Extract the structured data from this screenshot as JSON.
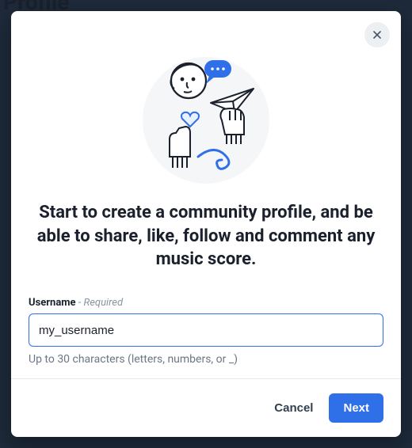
{
  "background": {
    "page_title": "Profile"
  },
  "modal": {
    "heading": "Start to create a community profile, and be able to share, like, follow and comment any music score.",
    "field": {
      "label": "Username",
      "required_text": "- Required",
      "value": "my_username",
      "helper": "Up to 30 characters (letters, numbers, or _)"
    },
    "actions": {
      "cancel": "Cancel",
      "next": "Next"
    }
  }
}
